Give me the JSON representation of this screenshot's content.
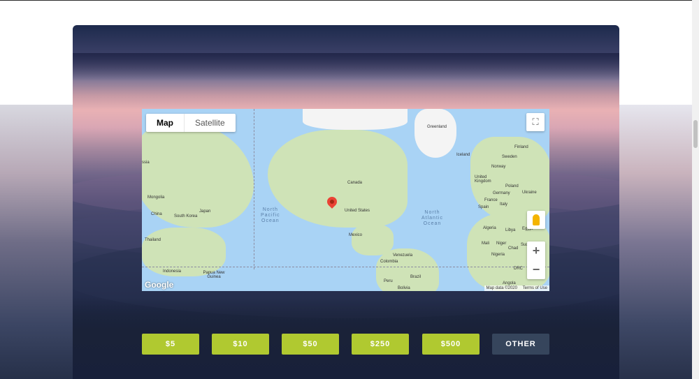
{
  "map": {
    "type_controls": [
      "Map",
      "Satellite"
    ],
    "labels": [
      "Greenland",
      "Iceland",
      "Finland",
      "Sweden",
      "Norway",
      "United Kingdom",
      "Poland",
      "Germany",
      "Ukraine",
      "France",
      "Italy",
      "Spain",
      "Algeria",
      "Libya",
      "Egypt",
      "Mali",
      "Niger",
      "Chad",
      "Sudan",
      "Nigeria",
      "DRC",
      "Angola",
      "Canada",
      "United States",
      "Mexico",
      "Venezuela",
      "Colombia",
      "Peru",
      "Brazil",
      "Bolivia",
      "Mongolia",
      "China",
      "South Korea",
      "Japan",
      "Thailand",
      "Indonesia",
      "Papua New Guinea",
      "ssia"
    ],
    "oceans": [
      "North\nPacific\nOcean",
      "North\nAtlantic\nOcean"
    ],
    "logo": "Google",
    "attribution": "Map data ©2020",
    "terms": "Terms of Use",
    "zoom_in": "+",
    "zoom_out": "−",
    "fullscreen_icon": "fullscreen-icon",
    "pegman_icon": "pegman-icon"
  },
  "amounts": [
    "$5",
    "$10",
    "$50",
    "$250",
    "$500",
    "OTHER"
  ],
  "colors": {
    "amount_button": "#b0c930",
    "other_button": "#36455c",
    "marker": "#ea4335"
  }
}
